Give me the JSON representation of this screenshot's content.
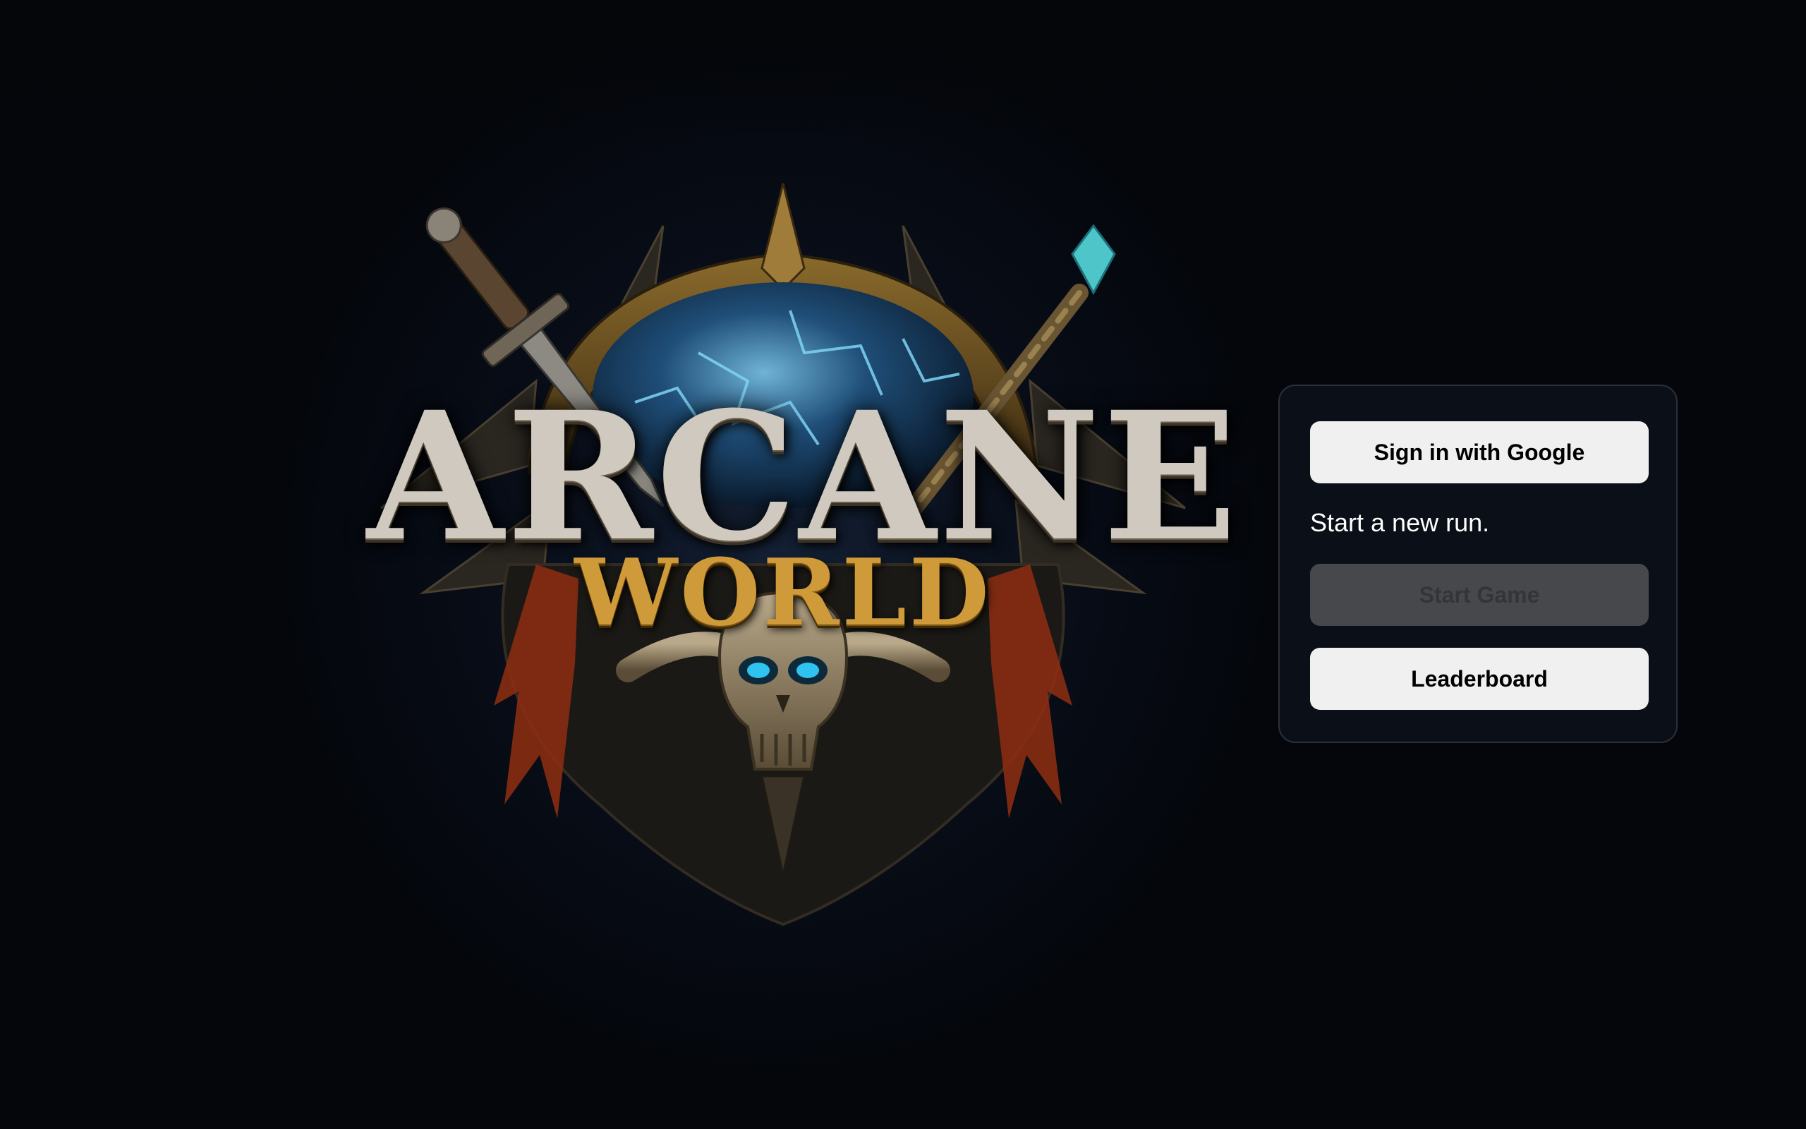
{
  "logo": {
    "title_main": "ARCANE",
    "title_sub": "WORLD"
  },
  "panel": {
    "signin_label": "Sign in with Google",
    "status_text": "Start a new run.",
    "start_label": "Start Game",
    "start_enabled": false,
    "leaderboard_label": "Leaderboard"
  },
  "colors": {
    "background": "#05070c",
    "panel_bg": "#0b0f17",
    "panel_border": "#2a2f3a",
    "button_light": "#f0f0f0",
    "button_disabled": "#47484c",
    "title_silver": "#cfc9bf",
    "title_gold": "#cf9a3a",
    "orb_blue": "#3aa6d8",
    "skull_eye_blue": "#2ec3f0"
  }
}
